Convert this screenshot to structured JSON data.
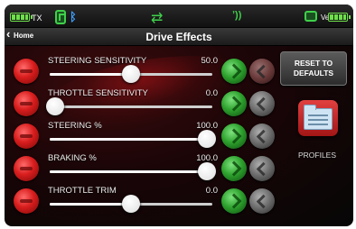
{
  "status_bar": {
    "tx_label": "TX",
    "veh_label": "Veh",
    "tx_battery_level": 1.0,
    "veh_battery_level": 1.0
  },
  "header": {
    "back_label": "Home",
    "title": "Drive Effects"
  },
  "settings": [
    {
      "label": "STEERING SENSITIVITY",
      "value": "50.0",
      "level": 0.5,
      "reverse_active": true
    },
    {
      "label": "THROTTLE SENSITIVITY",
      "value": "0.0",
      "level": 0.0,
      "reverse_active": false
    },
    {
      "label": "STEERING %",
      "value": "100.0",
      "level": 1.0,
      "reverse_active": false
    },
    {
      "label": "BRAKING %",
      "value": "100.0",
      "level": 1.0,
      "reverse_active": false
    },
    {
      "label": "THROTTLE TRIM",
      "value": "0.0",
      "level": 0.5,
      "reverse_active": false
    }
  ],
  "side_panel": {
    "reset_label_line1": "RESET TO",
    "reset_label_line2": "DEFAULTS",
    "profiles_label": "PROFILES"
  },
  "colors": {
    "accent_green": "#3fd04a",
    "minus_red": "#d81d1d",
    "plus_green": "#2ea22e",
    "profiles_red": "#c72a2a"
  },
  "icons": {
    "status": [
      "battery-icon",
      "phone-icon",
      "bluetooth-icon",
      "sync-arrows-icon",
      "signal-icon",
      "vehicle-icon",
      "battery-icon"
    ],
    "row_controls": [
      "minus-icon",
      "plus-icon",
      "reverse-icon"
    ],
    "profiles": "folder-icon"
  }
}
